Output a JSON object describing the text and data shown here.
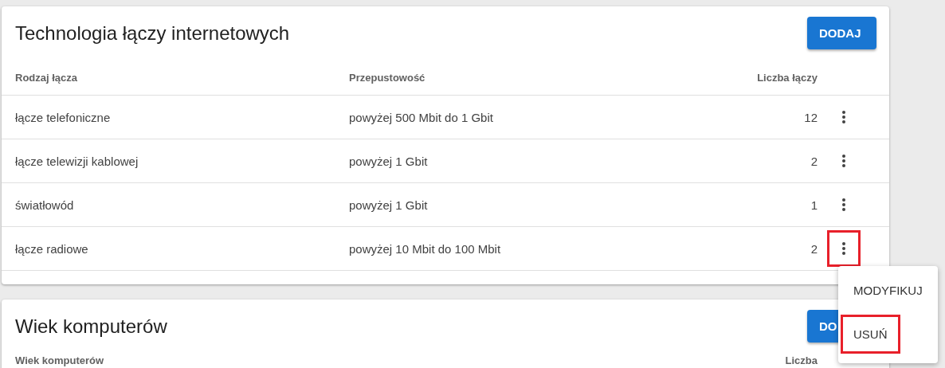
{
  "sections": [
    {
      "title": "Technologia łączy internetowych",
      "button": "DODAJ",
      "columns": [
        "Rodzaj łącza",
        "Przepustowość",
        "Liczba łączy"
      ],
      "rows": [
        {
          "cells": [
            "łącze telefoniczne",
            "powyżej 500 Mbit do 1 Gbit",
            "12"
          ],
          "highlighted": false
        },
        {
          "cells": [
            "łącze telewizji kablowej",
            "powyżej 1 Gbit",
            "2"
          ],
          "highlighted": false
        },
        {
          "cells": [
            "światłowód",
            "powyżej 1 Gbit",
            "1"
          ],
          "highlighted": false
        },
        {
          "cells": [
            "łącze radiowe",
            "powyżej 10 Mbit do 100 Mbit",
            "2"
          ],
          "highlighted": true
        }
      ]
    },
    {
      "title": "Wiek komputerów",
      "button": "DO",
      "columns": [
        "Wiek komputerów",
        "Liczba"
      ]
    }
  ],
  "context_menu": {
    "items": [
      {
        "label": "MODYFIKUJ",
        "highlighted": false
      },
      {
        "label": "USUŃ",
        "highlighted": true
      }
    ]
  }
}
